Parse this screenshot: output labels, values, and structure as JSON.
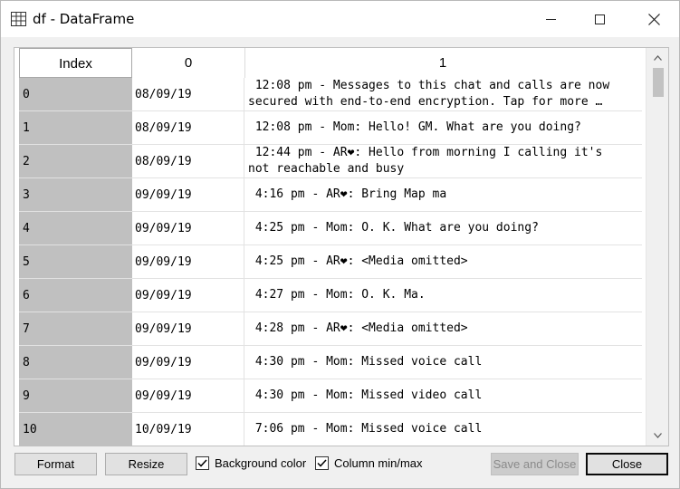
{
  "window": {
    "title": "df - DataFrame"
  },
  "table": {
    "headers": {
      "index": "Index",
      "col0": "0",
      "col1": "1"
    },
    "rows": [
      {
        "index": "0",
        "date": "08/09/19",
        "msg": " 12:08 pm - Messages to this chat and calls are now\nsecured with end-to-end encryption. Tap for more …"
      },
      {
        "index": "1",
        "date": "08/09/19",
        "msg": " 12:08 pm - Mom: Hello! GM. What are you doing?"
      },
      {
        "index": "2",
        "date": "08/09/19",
        "msg": " 12:44 pm - AR❤: Hello from morning I calling it's\nnot reachable and busy"
      },
      {
        "index": "3",
        "date": "09/09/19",
        "msg": " 4:16 pm - AR❤: Bring Map ma"
      },
      {
        "index": "4",
        "date": "09/09/19",
        "msg": " 4:25 pm - Mom: O. K. What are you doing?"
      },
      {
        "index": "5",
        "date": "09/09/19",
        "msg": " 4:25 pm - AR❤: <Media omitted>"
      },
      {
        "index": "6",
        "date": "09/09/19",
        "msg": " 4:27 pm - Mom: O. K. Ma."
      },
      {
        "index": "7",
        "date": "09/09/19",
        "msg": " 4:28 pm - AR❤: <Media omitted>"
      },
      {
        "index": "8",
        "date": "09/09/19",
        "msg": " 4:30 pm - Mom: Missed voice call"
      },
      {
        "index": "9",
        "date": "09/09/19",
        "msg": " 4:30 pm - Mom: Missed video call"
      },
      {
        "index": "10",
        "date": "10/09/19",
        "msg": " 7:06 pm - Mom: Missed voice call"
      }
    ]
  },
  "buttons": {
    "format": "Format",
    "resize": "Resize",
    "save_and_close": "Save and Close",
    "close": "Close"
  },
  "options": {
    "background_color": {
      "label": "Background color",
      "checked": true
    },
    "column_minmax": {
      "label": "Column min/max",
      "checked": true
    }
  },
  "icons": {
    "title": "table-grid-icon",
    "minimize": "minimize-icon",
    "maximize": "maximize-icon",
    "close": "close-icon",
    "scroll_up": "chevron-up-icon",
    "scroll_down": "chevron-down-icon",
    "checkbox": "checkmark-icon"
  },
  "colors": {
    "index_column_bg": "#c0c0c0",
    "window_bg": "#f0f0f0",
    "disabled_text": "#8a8a8a"
  }
}
